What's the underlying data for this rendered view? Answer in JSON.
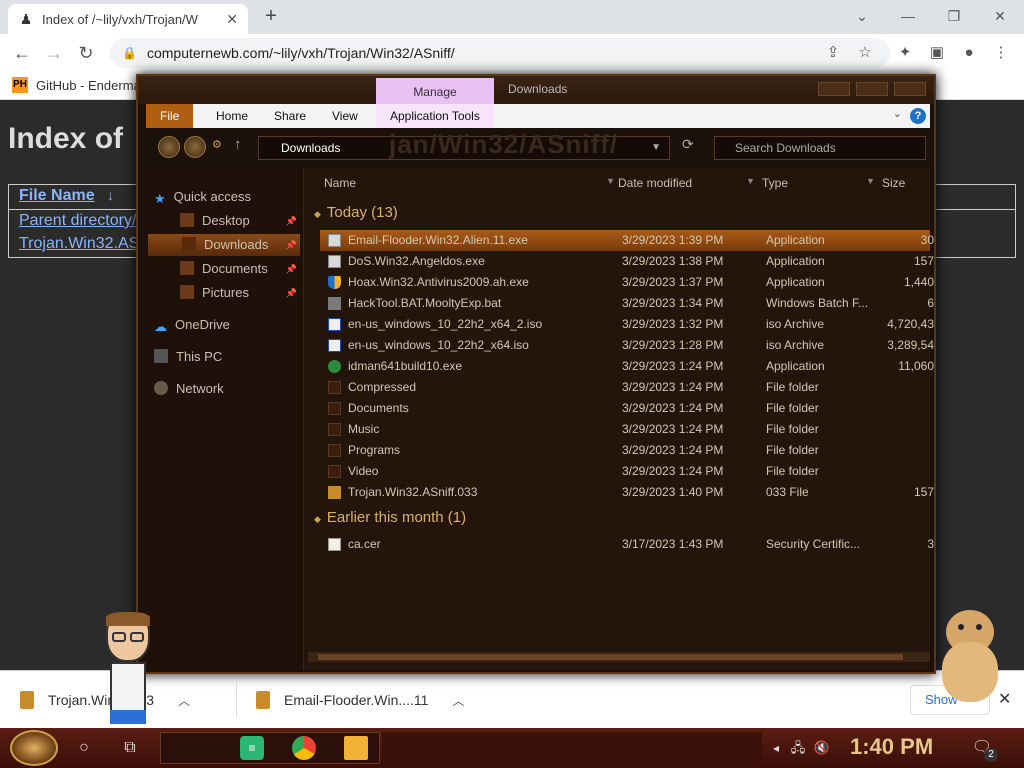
{
  "browser": {
    "tab_title": "Index of /~lily/vxh/Trojan/W",
    "url": "computernewb.com/~lily/vxh/Trojan/Win32/ASniff/",
    "bookmark": "GitHub - Enderma"
  },
  "page": {
    "heading": "Index of",
    "col_file_name": "File Name",
    "col_sort": "↓",
    "link_parent": "Parent directory/",
    "link_file": "Trojan.Win32.AS"
  },
  "explorer": {
    "manage_label": "Manage",
    "title": "Downloads",
    "ribbon": [
      "File",
      "Home",
      "Share",
      "View",
      "Application Tools"
    ],
    "address": "Downloads",
    "address_ghost": "jan/Win32/ASniff/",
    "search_placeholder": "Search Downloads",
    "sidebar": {
      "quick_access": "Quick access",
      "desktop": "Desktop",
      "downloads": "Downloads",
      "documents": "Documents",
      "pictures": "Pictures",
      "onedrive": "OneDrive",
      "this_pc": "This PC",
      "network": "Network"
    },
    "columns": {
      "name": "Name",
      "date": "Date modified",
      "type": "Type",
      "size": "Size"
    },
    "groups": {
      "today": "Today (13)",
      "earlier": "Earlier this month (1)"
    },
    "files": [
      {
        "name": "Email-Flooder.Win32.Alien.11.exe",
        "date": "3/29/2023 1:39 PM",
        "type": "Application",
        "size": "30",
        "icon": "exe-icon"
      },
      {
        "name": "DoS.Win32.Angeldos.exe",
        "date": "3/29/2023 1:38 PM",
        "type": "Application",
        "size": "157",
        "icon": "exe-icon"
      },
      {
        "name": "Hoax.Win32.Antivirus2009.ah.exe",
        "date": "3/29/2023 1:37 PM",
        "type": "Application",
        "size": "1,440",
        "icon": "shield-icon"
      },
      {
        "name": "HackTool.BAT.MooltyExp.bat",
        "date": "3/29/2023 1:34 PM",
        "type": "Windows Batch F...",
        "size": "6",
        "icon": "batch-icon"
      },
      {
        "name": "en-us_windows_10_22h2_x64_2.iso",
        "date": "3/29/2023 1:32 PM",
        "type": "iso Archive",
        "size": "4,720,43",
        "icon": "iso-icon"
      },
      {
        "name": "en-us_windows_10_22h2_x64.iso",
        "date": "3/29/2023 1:28 PM",
        "type": "iso Archive",
        "size": "3,289,54",
        "icon": "iso-icon"
      },
      {
        "name": "idman641build10.exe",
        "date": "3/29/2023 1:24 PM",
        "type": "Application",
        "size": "11,060",
        "icon": "download-manager-icon"
      },
      {
        "name": "Compressed",
        "date": "3/29/2023 1:24 PM",
        "type": "File folder",
        "size": "",
        "icon": "folder-icon"
      },
      {
        "name": "Documents",
        "date": "3/29/2023 1:24 PM",
        "type": "File folder",
        "size": "",
        "icon": "folder-icon"
      },
      {
        "name": "Music",
        "date": "3/29/2023 1:24 PM",
        "type": "File folder",
        "size": "",
        "icon": "folder-icon"
      },
      {
        "name": "Programs",
        "date": "3/29/2023 1:24 PM",
        "type": "File folder",
        "size": "",
        "icon": "folder-icon"
      },
      {
        "name": "Video",
        "date": "3/29/2023 1:24 PM",
        "type": "File folder",
        "size": "",
        "icon": "folder-icon"
      },
      {
        "name": "Trojan.Win32.ASniff.033",
        "date": "3/29/2023 1:40 PM",
        "type": "033 File",
        "size": "157",
        "icon": "file-icon"
      }
    ],
    "earlier_files": [
      {
        "name": "ca.cer",
        "date": "3/17/2023 1:43 PM",
        "type": "Security Certific...",
        "size": "3",
        "icon": "certificate-icon"
      }
    ]
  },
  "downloads_bar": {
    "item1": "Trojan.Win....033",
    "item2": "Email-Flooder.Win....11",
    "show_all": "Show"
  },
  "taskbar": {
    "time": "1:40 PM",
    "notif_count": "2"
  },
  "colors": {
    "accent": "#b05e12",
    "selection": "#a85a18",
    "group": "#d8b070"
  }
}
